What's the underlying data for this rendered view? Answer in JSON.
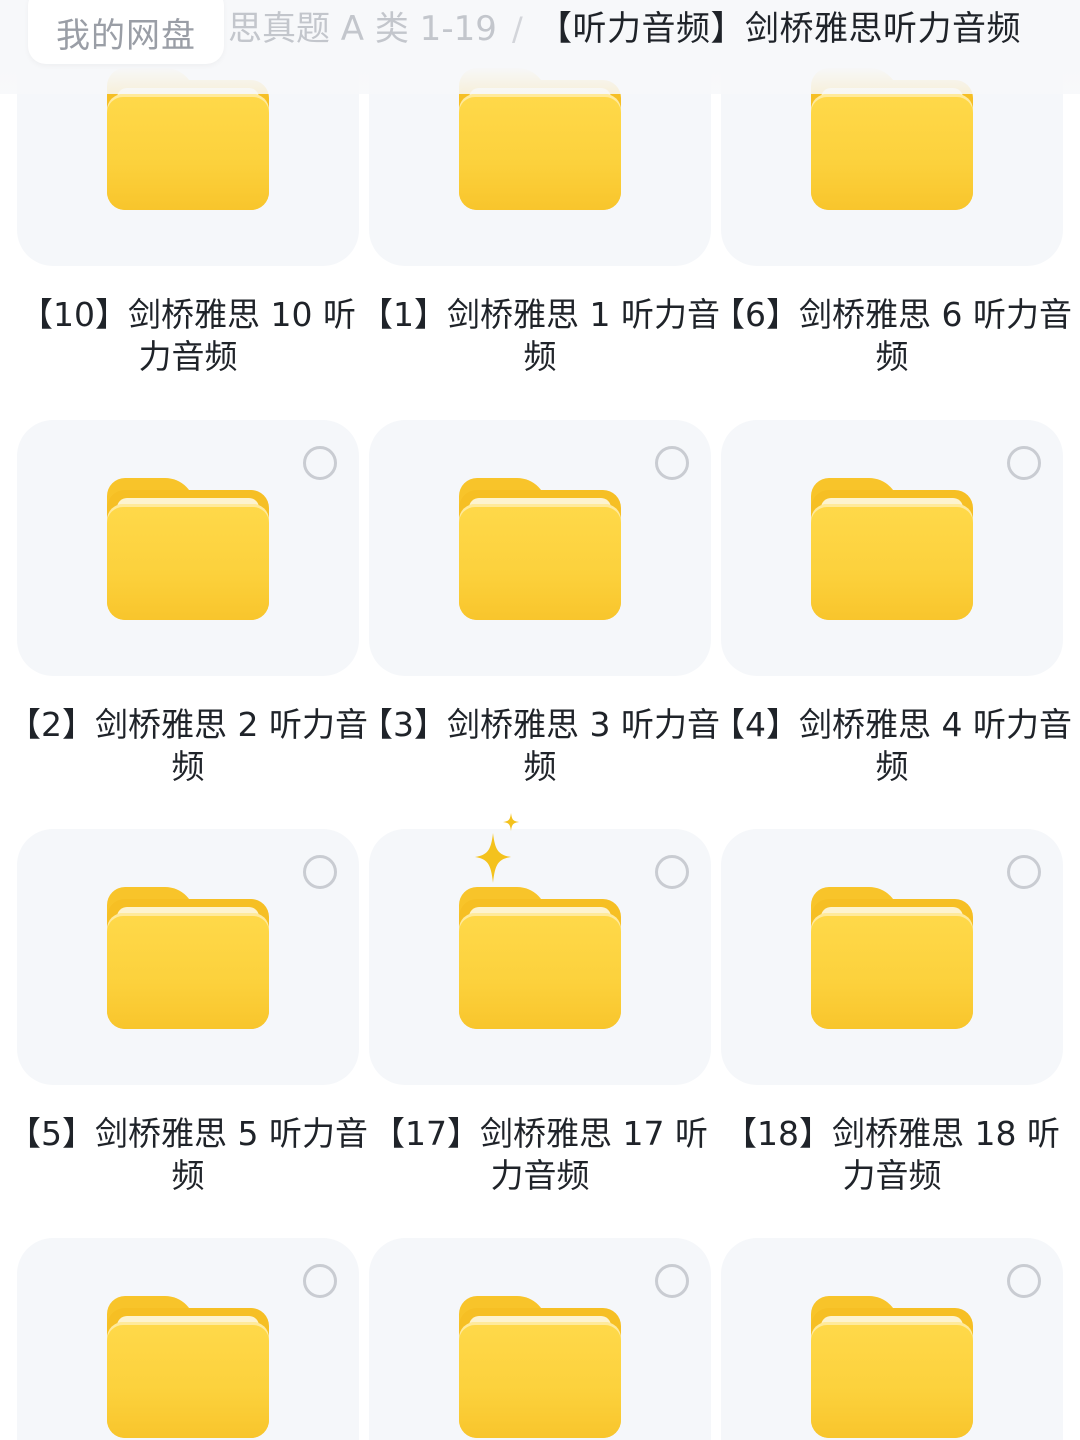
{
  "breadcrumb": {
    "home": "我的网盘",
    "parent": "思真题 A 类 1-19",
    "separator": "/",
    "current": "【听力音频】剑桥雅思听力音频"
  },
  "colors": {
    "folder_yellow": "#fcd13c",
    "card_bg": "#f5f7fa",
    "text_primary": "#1f2329",
    "text_muted": "#9a9ea6"
  },
  "folders": [
    {
      "label": "【10】剑桥雅思 10 听力音频",
      "icon": "folder-icon"
    },
    {
      "label": "【1】剑桥雅思 1 听力音频",
      "icon": "folder-icon"
    },
    {
      "label": "【6】剑桥雅思 6 听力音频",
      "icon": "folder-icon"
    },
    {
      "label": "【2】剑桥雅思 2 听力音频",
      "icon": "folder-icon"
    },
    {
      "label": "【3】剑桥雅思 3 听力音频",
      "icon": "folder-icon"
    },
    {
      "label": "【4】剑桥雅思 4 听力音频",
      "icon": "folder-icon"
    },
    {
      "label": "【5】剑桥雅思 5 听力音频",
      "icon": "folder-icon"
    },
    {
      "label": "【17】剑桥雅思 17 听力音频",
      "icon": "folder-icon"
    },
    {
      "label": "【18】剑桥雅思 18 听力音频",
      "icon": "folder-icon"
    },
    {
      "label": "",
      "icon": "folder-icon"
    },
    {
      "label": "",
      "icon": "folder-icon"
    },
    {
      "label": "",
      "icon": "folder-icon"
    }
  ]
}
